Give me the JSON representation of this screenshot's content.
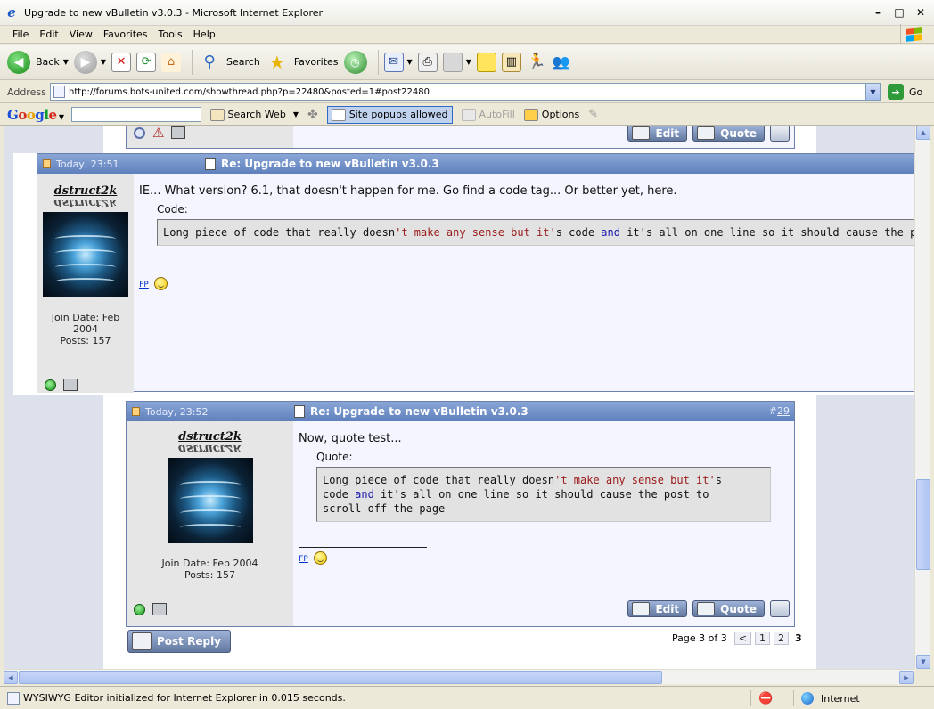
{
  "window": {
    "title": "Upgrade to new vBulletin v3.0.3 - Microsoft Internet Explorer"
  },
  "menu": [
    "File",
    "Edit",
    "View",
    "Favorites",
    "Tools",
    "Help"
  ],
  "toolbar": {
    "back": "Back",
    "search": "Search",
    "favorites": "Favorites"
  },
  "address": {
    "label": "Address",
    "url": "http://forums.bots-united.com/showthread.php?p=22480&posted=1#post22480",
    "go": "Go"
  },
  "google": {
    "logo": "Google",
    "search_web": "Search Web",
    "popups": "Site popups allowed",
    "autofill": "AutoFill",
    "options": "Options"
  },
  "posts": [
    {
      "date": "Today, 23:51",
      "title": "Re: Upgrade to new vBulletin v3.0.3",
      "username": "dstruct2k",
      "join": "Join Date: Feb 2004",
      "posts": "Posts: 157",
      "message": "IE... What version? 6.1, that doesn't happen for me. Go find a code tag... Or better yet, here.",
      "box_label": "Code:",
      "code": [
        "Long piece of code that really doesn",
        "'t make any sense but it'",
        "s code ",
        "and",
        " it",
        "'s all on one line so it should cause the post to scroll off the page"
      ],
      "sig": "FP"
    },
    {
      "date": "Today, 23:52",
      "title": "Re: Upgrade to new vBulletin v3.0.3",
      "number_prefix": "#",
      "number": "29",
      "username": "dstruct2k",
      "join": "Join Date: Feb 2004",
      "posts": "Posts: 157",
      "message": "Now, quote test...",
      "box_label": "Quote:",
      "code": [
        "Long piece of code that really doesn",
        "'t make any sense but it'",
        "s\ncode ",
        "and",
        " it",
        "'s all on one line so it should cause the post to\nscroll off the page"
      ],
      "sig": "FP"
    }
  ],
  "buttons": {
    "edit": "Edit",
    "quote": "Quote",
    "post_reply": "Post Reply"
  },
  "pager": {
    "text": "Page 3 of 3",
    "prev": "<",
    "pages": [
      "1",
      "2"
    ],
    "current": "3"
  },
  "status": {
    "text": "WYSIWYG Editor initialized for Internet Explorer in 0.015 seconds.",
    "zone": "Internet"
  },
  "colors": {
    "post_header": "#6f8fc9",
    "page_bg": "#dde1ec",
    "code_red": "#9b1b1b",
    "code_blue": "#1b1bb0"
  }
}
